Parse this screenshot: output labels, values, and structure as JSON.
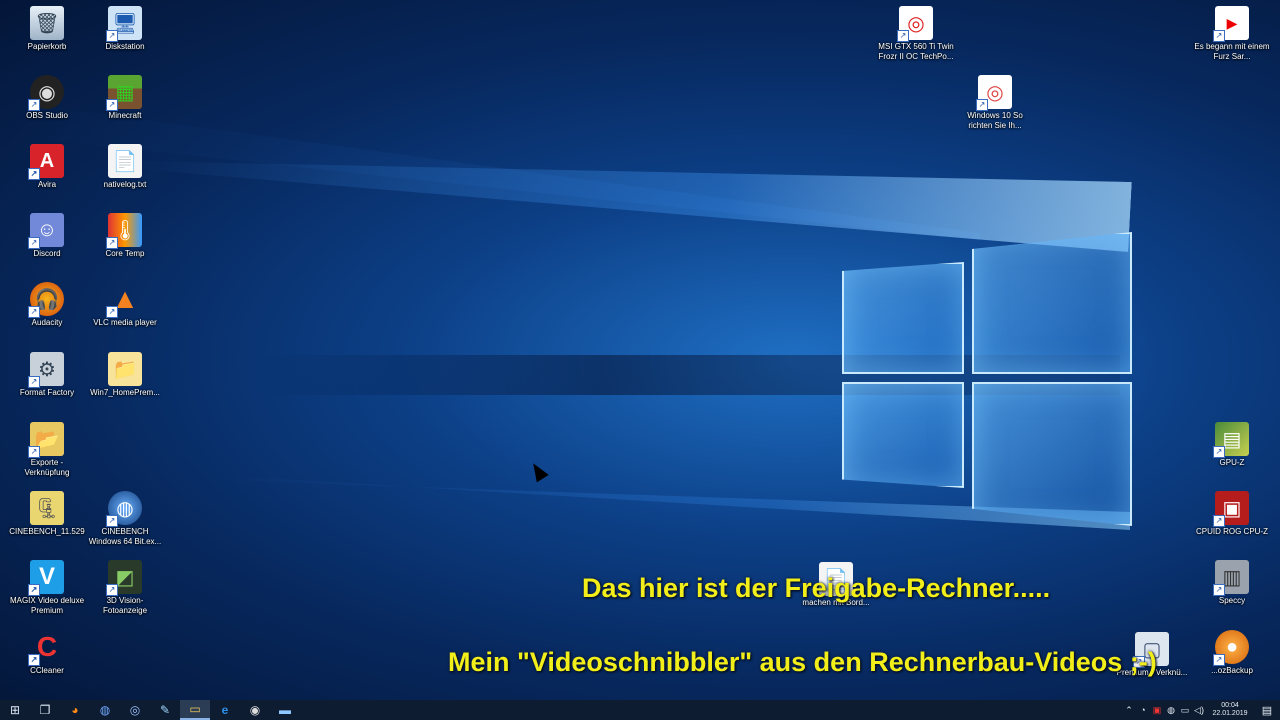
{
  "desktop_icons_left": [
    {
      "label": "Papierkorb",
      "icon": "recycle-bin-icon",
      "glyph": "🗑"
    },
    {
      "label": "Diskstation",
      "icon": "network-drive-icon",
      "glyph": "🖥"
    },
    {
      "label": "OBS Studio",
      "icon": "obs-icon",
      "glyph": "◉"
    },
    {
      "label": "Minecraft",
      "icon": "minecraft-icon",
      "glyph": "▦"
    },
    {
      "label": "Avira",
      "icon": "avira-icon",
      "glyph": "A"
    },
    {
      "label": "nativelog.txt",
      "icon": "text-file-icon",
      "glyph": "📄"
    },
    {
      "label": "Discord",
      "icon": "discord-icon",
      "glyph": "☺"
    },
    {
      "label": "Core Temp",
      "icon": "core-temp-icon",
      "glyph": "🌡"
    },
    {
      "label": "Audacity",
      "icon": "audacity-icon",
      "glyph": "🎧"
    },
    {
      "label": "VLC media player",
      "icon": "vlc-icon",
      "glyph": "▲"
    },
    {
      "label": "Format Factory",
      "icon": "format-factory-icon",
      "glyph": "⚙"
    },
    {
      "label": "Win7_HomePrem...",
      "icon": "folder-icon",
      "glyph": "📁"
    },
    {
      "label": "Exporte - Verknüpfung",
      "icon": "folder-shortcut-icon",
      "glyph": "📂"
    },
    {
      "label": "CINEBENCH_11.529",
      "icon": "zip-folder-icon",
      "glyph": "🗜"
    },
    {
      "label": "CINEBENCH Windows 64 Bit.ex...",
      "icon": "cinebench-icon",
      "glyph": "◍"
    },
    {
      "label": "MAGIX Video deluxe Premium",
      "icon": "magix-icon",
      "glyph": "V"
    },
    {
      "label": "3D Vision-Fotoanzeige",
      "icon": "3d-vision-icon",
      "glyph": "◩"
    },
    {
      "label": "CCleaner",
      "icon": "ccleaner-icon",
      "glyph": "C"
    }
  ],
  "desktop_icons_right": [
    {
      "label": "MSI GTX 560 Ti Twin Frozr II OC TechPo...",
      "icon": "web-shortcut-icon",
      "glyph": "◎"
    },
    {
      "label": "Windows 10 So richten Sie Ih...",
      "icon": "web-shortcut-icon",
      "glyph": "◎"
    },
    {
      "label": "Es begann mit einem Furz Sar...",
      "icon": "youtube-shortcut-icon",
      "glyph": "▶"
    },
    {
      "label": "GPU-Z",
      "icon": "gpu-z-icon",
      "glyph": "▤"
    },
    {
      "label": "CPUID ROG CPU-Z",
      "icon": "cpu-z-icon",
      "glyph": "▣"
    },
    {
      "label": "Speccy",
      "icon": "speccy-icon",
      "glyph": "▥"
    },
    {
      "label": "...ozBackup",
      "icon": "backup-icon",
      "glyph": "●"
    },
    {
      "label": "machen mit Bord...",
      "icon": "document-icon",
      "glyph": "📄"
    },
    {
      "label": "Premium - Verknü...",
      "icon": "shortcut-icon",
      "glyph": "▢"
    }
  ],
  "subtitles": {
    "line1": "Das hier ist der Freigabe-Rechner.....",
    "line2": "Mein \"Videoschnibbler\" aus den Rechnerbau-Videos ;-)"
  },
  "taskbar": {
    "items": [
      {
        "name": "start-button",
        "glyph": "⊞"
      },
      {
        "name": "task-view-button",
        "glyph": "❐"
      },
      {
        "name": "firefox-button",
        "glyph": "◕"
      },
      {
        "name": "app-button-2",
        "glyph": "◍"
      },
      {
        "name": "app-button-3",
        "glyph": "◎"
      },
      {
        "name": "app-button-4",
        "glyph": "✎"
      },
      {
        "name": "file-explorer-button",
        "glyph": "▭"
      },
      {
        "name": "edge-button",
        "glyph": "e"
      },
      {
        "name": "obs-button",
        "glyph": "◉"
      },
      {
        "name": "app-button-9",
        "glyph": "▬"
      }
    ],
    "clock_time": "00:04",
    "clock_date": "22.01.2019"
  }
}
